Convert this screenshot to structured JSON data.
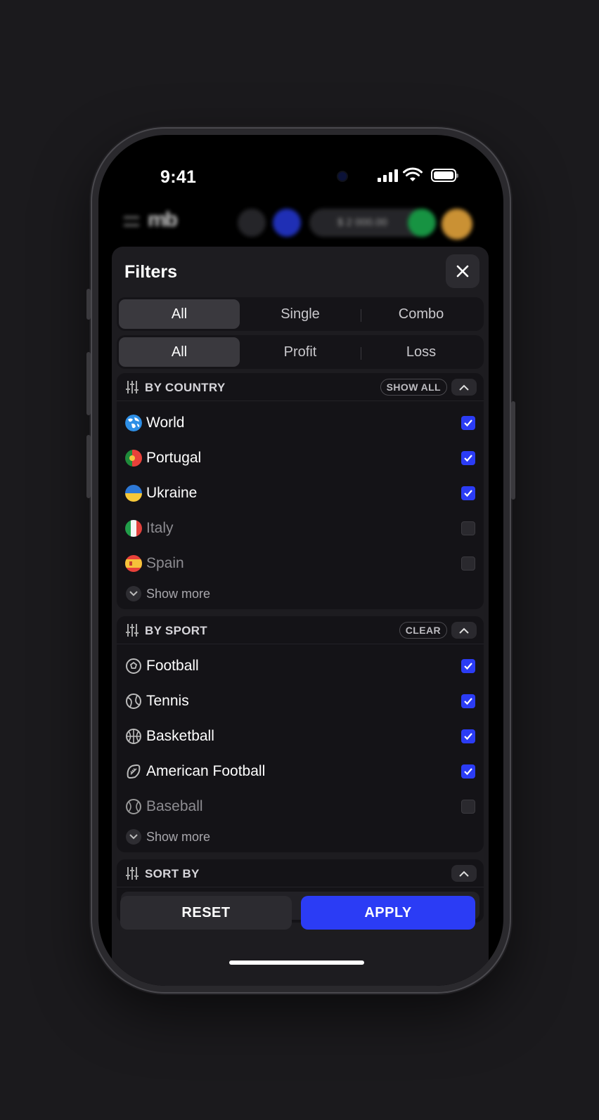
{
  "status_bar": {
    "time": "9:41"
  },
  "app_bar": {
    "logo": "mb",
    "balance": "$ 2 000.00"
  },
  "sheet": {
    "title": "Filters"
  },
  "type_segment": {
    "options": [
      "All",
      "Single",
      "Combo"
    ],
    "selected": "All"
  },
  "result_segment": {
    "options": [
      "All",
      "Profit",
      "Loss"
    ],
    "selected": "All"
  },
  "by_country": {
    "title": "BY COUNTRY",
    "action": "SHOW ALL",
    "items": [
      {
        "label": "World",
        "icon": "globe-icon",
        "checked": true
      },
      {
        "label": "Portugal",
        "icon": "portugal-flag-icon",
        "checked": true
      },
      {
        "label": "Ukraine",
        "icon": "ukraine-flag-icon",
        "checked": true
      },
      {
        "label": "Italy",
        "icon": "italy-flag-icon",
        "checked": false
      },
      {
        "label": "Spain",
        "icon": "spain-flag-icon",
        "checked": false
      }
    ],
    "show_more": "Show more"
  },
  "by_sport": {
    "title": "BY SPORT",
    "action": "CLEAR",
    "items": [
      {
        "label": "Football",
        "icon": "football-icon",
        "checked": true
      },
      {
        "label": "Tennis",
        "icon": "tennis-icon",
        "checked": true
      },
      {
        "label": "Basketball",
        "icon": "basketball-icon",
        "checked": true
      },
      {
        "label": "American Football",
        "icon": "american-football-icon",
        "checked": true
      },
      {
        "label": "Baseball",
        "icon": "baseball-icon",
        "checked": false
      }
    ],
    "show_more": "Show more"
  },
  "sort_by": {
    "title": "SORT BY"
  },
  "footer": {
    "reset_label": "RESET",
    "apply_label": "APPLY"
  },
  "colors": {
    "accent": "#2b3cf5",
    "sheet_bg": "#1d1c20",
    "section_bg": "#141317"
  }
}
